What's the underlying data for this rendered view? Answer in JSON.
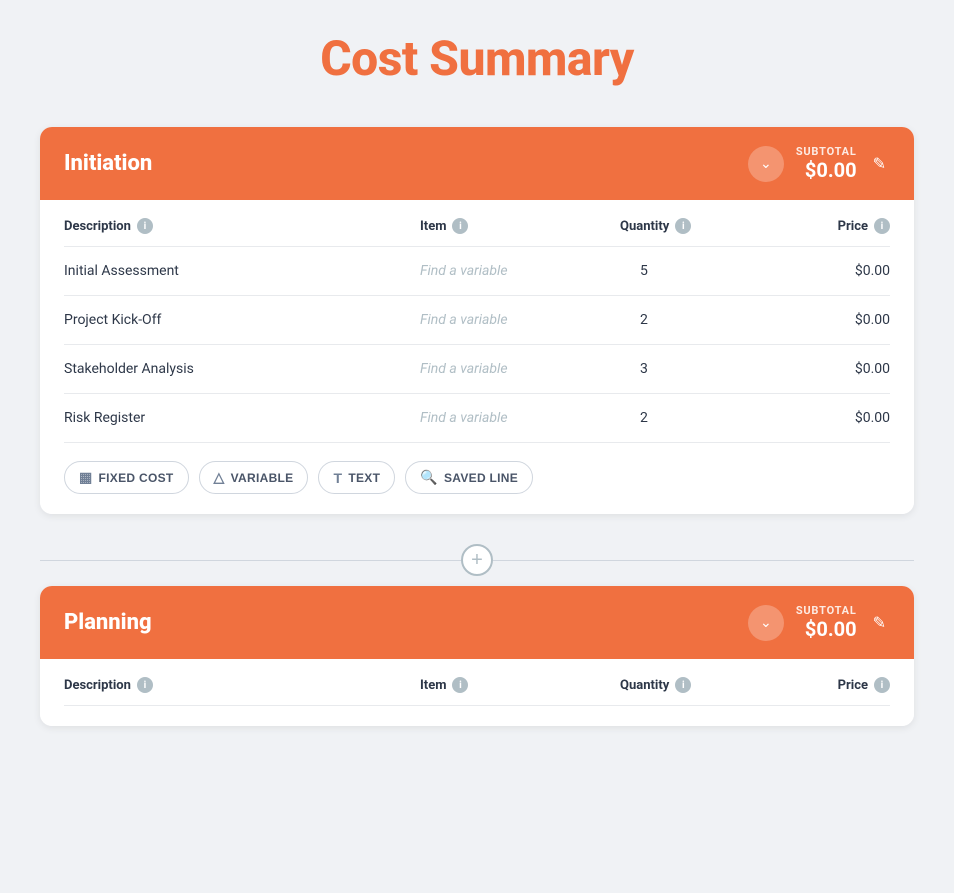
{
  "page": {
    "title": "Cost Summary"
  },
  "sections": [
    {
      "id": "initiation",
      "title": "Initiation",
      "subtotal_label": "SUBTOTAL",
      "subtotal_value": "$0.00",
      "columns": {
        "description": "Description",
        "item": "Item",
        "quantity": "Quantity",
        "price": "Price"
      },
      "rows": [
        {
          "description": "Initial Assessment",
          "item": "Find a variable",
          "quantity": "5",
          "price": "$0.00"
        },
        {
          "description": "Project Kick-Off",
          "item": "Find a variable",
          "quantity": "2",
          "price": "$0.00"
        },
        {
          "description": "Stakeholder Analysis",
          "item": "Find a variable",
          "quantity": "3",
          "price": "$0.00"
        },
        {
          "description": "Risk Register",
          "item": "Find a variable",
          "quantity": "2",
          "price": "$0.00"
        }
      ],
      "add_buttons": [
        {
          "id": "fixed-cost",
          "label": "FIXED COST",
          "icon": "▦"
        },
        {
          "id": "variable",
          "label": "VARIABLE",
          "icon": "△"
        },
        {
          "id": "text",
          "label": "TEXT",
          "icon": "T"
        },
        {
          "id": "saved-line",
          "label": "SAVED LINE",
          "icon": "🔍"
        }
      ]
    },
    {
      "id": "planning",
      "title": "Planning",
      "subtotal_label": "SUBTOTAL",
      "subtotal_value": "$0.00",
      "columns": {
        "description": "Description",
        "item": "Item",
        "quantity": "Quantity",
        "price": "Price"
      },
      "rows": []
    }
  ],
  "add_section": {
    "icon": "+"
  }
}
